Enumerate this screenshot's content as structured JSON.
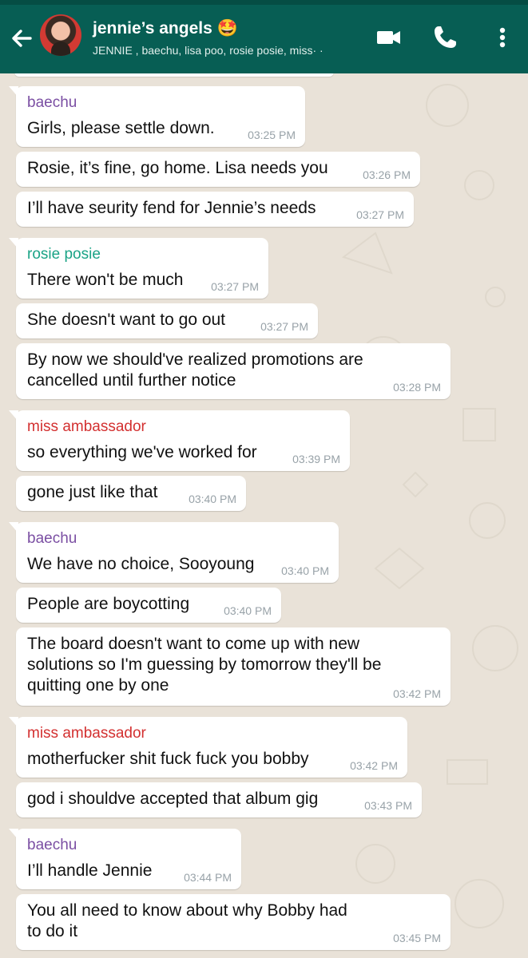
{
  "header": {
    "title": "jennie’s angels 🤩",
    "subtitle": "JENNIE , baechu, lisa poo, rosie posie, miss· ·"
  },
  "colors": {
    "header_bg": "#075e54",
    "baechu": "#7b4fa3",
    "rosie": "#1aa386",
    "miss": "#d33030",
    "time": "#98a2a8"
  },
  "icons": {
    "back": "arrow-left",
    "video": "video-camera",
    "call": "phone",
    "menu": "more-vertical"
  },
  "messages": [
    {
      "sender": "baechu",
      "lines": [
        "Girls, please settle down."
      ],
      "time": "03:25 PM"
    },
    {
      "lines": [
        "Rosie, it’s fine, go home. Lisa needs you"
      ],
      "time": "03:26 PM"
    },
    {
      "lines": [
        "I’ll have seurity fend for Jennie’s needs"
      ],
      "time": "03:27 PM"
    },
    {
      "sender": "rosie posie",
      "lines": [
        "There won't be much"
      ],
      "time": "03:27 PM"
    },
    {
      "lines": [
        "She doesn't want to go out"
      ],
      "time": "03:27 PM"
    },
    {
      "lines": [
        "By now we should've realized promotions are",
        "cancelled until further notice"
      ],
      "time": "03:28 PM"
    },
    {
      "sender": "miss ambassador",
      "lines": [
        "so everything we've worked for"
      ],
      "time": "03:39 PM"
    },
    {
      "lines": [
        "gone just like that"
      ],
      "time": "03:40 PM"
    },
    {
      "sender": "baechu",
      "lines": [
        "We have no choice, Sooyoung"
      ],
      "time": "03:40 PM"
    },
    {
      "lines": [
        "People are boycotting"
      ],
      "time": "03:40 PM"
    },
    {
      "lines": [
        "The board doesn't want to come up with new",
        "solutions so I'm guessing by tomorrow they'll be",
        "quitting one by one"
      ],
      "time": "03:42 PM"
    },
    {
      "sender": "miss ambassador",
      "lines": [
        "motherfucker shit fuck fuck you bobby"
      ],
      "time": "03:42 PM"
    },
    {
      "lines": [
        "god i shouldve accepted that album gig"
      ],
      "time": "03:43 PM"
    },
    {
      "sender": "baechu",
      "lines": [
        "I’ll handle Jennie"
      ],
      "time": "03:44 PM"
    },
    {
      "lines": [
        "You all need to know about why Bobby had",
        "to do it"
      ],
      "time": "03:45 PM"
    }
  ]
}
